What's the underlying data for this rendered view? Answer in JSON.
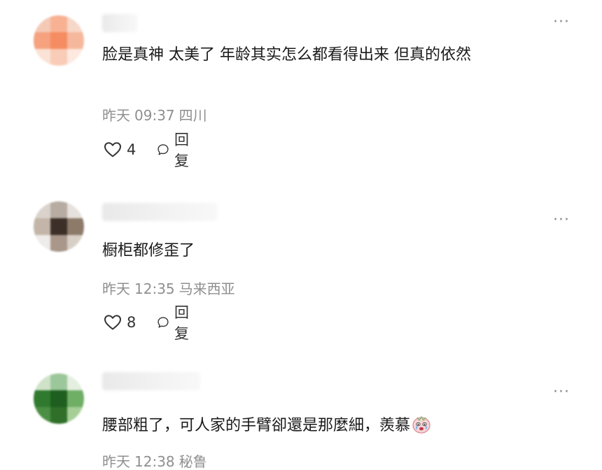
{
  "comments": [
    {
      "text": "脸是真神 太美了 年龄其实怎么都看得出来 但真的依然",
      "date": "昨天",
      "time": "09:37",
      "location": "四川",
      "likes": "4",
      "reply_label": "回复",
      "more_label": "···"
    },
    {
      "text": "橱柜都修歪了",
      "date": "昨天",
      "time": "12:35",
      "location": "马来西亚",
      "likes": "8",
      "reply_label": "回复",
      "more_label": "···"
    },
    {
      "text": "腰部粗了，可人家的手臂卻還是那麼細，羨慕",
      "date": "昨天",
      "time": "12:38",
      "location": "秘鲁",
      "more_label": "···",
      "emoji": "crying-face-emoji"
    }
  ]
}
